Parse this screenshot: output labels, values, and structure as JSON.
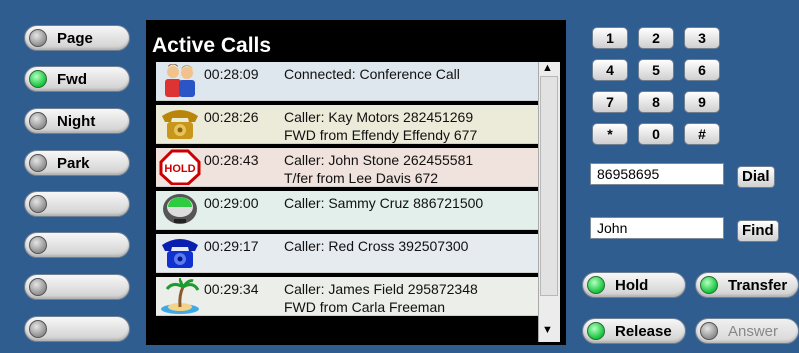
{
  "left_buttons": [
    {
      "label": "Page",
      "led": "off"
    },
    {
      "label": "Fwd",
      "led": "on"
    },
    {
      "label": "Night",
      "led": "off"
    },
    {
      "label": "Park",
      "led": "off"
    },
    {
      "label": "",
      "led": "off"
    },
    {
      "label": "",
      "led": "off"
    },
    {
      "label": "",
      "led": "off"
    },
    {
      "label": "",
      "led": "off"
    }
  ],
  "panel": {
    "title": "Active Calls"
  },
  "calls": [
    {
      "icon": "conference-icon",
      "time": "00:28:09",
      "line1": "Connected: Conference Call",
      "line2": "",
      "bg": "#dfe7ee"
    },
    {
      "icon": "phone-ringing-icon",
      "time": "00:28:26",
      "line1": "Caller: Kay Motors 282451269",
      "line2": "FWD from Effendy Effendy 677",
      "bg": "#ecebd9"
    },
    {
      "icon": "hold-sign-icon",
      "time": "00:28:43",
      "line1": "Caller: John Stone 262455581",
      "line2": "T/fer from Lee Davis 672",
      "bg": "#f0e2dc"
    },
    {
      "icon": "parking-meter-icon",
      "time": "00:29:00",
      "line1": "Caller: Sammy Cruz 886721500",
      "line2": "",
      "bg": "#e2efea"
    },
    {
      "icon": "blue-phone-icon",
      "time": "00:29:17",
      "line1": "Caller: Red Cross 392507300",
      "line2": "",
      "bg": "#e6ebef"
    },
    {
      "icon": "island-icon",
      "time": "00:29:34",
      "line1": "Caller: James Field 295872348",
      "line2": "FWD from Carla Freeman",
      "bg": "#eceee9"
    }
  ],
  "keypad": [
    "1",
    "2",
    "3",
    "4",
    "5",
    "6",
    "7",
    "8",
    "9",
    "*",
    "0",
    "#"
  ],
  "dial": {
    "value": "86958695",
    "button": "Dial"
  },
  "find": {
    "value": "John",
    "button": "Find"
  },
  "action_buttons": [
    {
      "label": "Hold",
      "led": "on",
      "enabled": true
    },
    {
      "label": "Transfer",
      "led": "on",
      "enabled": true
    },
    {
      "label": "Release",
      "led": "on",
      "enabled": true
    },
    {
      "label": "Answer",
      "led": "off",
      "enabled": false
    }
  ]
}
